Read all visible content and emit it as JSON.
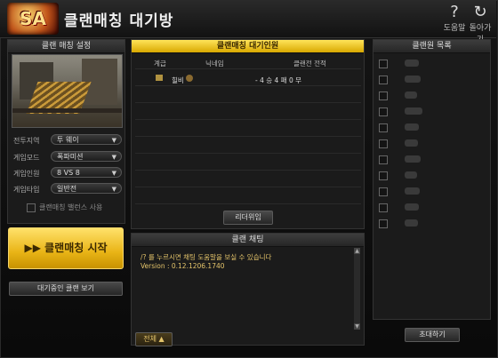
{
  "header": {
    "logo_text": "SA",
    "title": "클랜매칭 대기방",
    "help_label": "도움말",
    "back_label": "돌아가기",
    "help_icon": "question-icon",
    "back_icon": "return-arrow-icon"
  },
  "settings": {
    "title": "클랜 매칭 설정",
    "fields": [
      {
        "label": "전투지역",
        "value": "투 웨이"
      },
      {
        "label": "게임모드",
        "value": "폭파미션"
      },
      {
        "label": "게임인원",
        "value": "8 VS 8"
      },
      {
        "label": "게임타입",
        "value": "일반전"
      }
    ],
    "balance_label": "클랜매칭 밸런스 사용",
    "start_label": "클랜매칭 시작",
    "waiting_clans_label": "대기중인 클랜 보기"
  },
  "waiting": {
    "title": "클랜매칭 대기인원",
    "columns": [
      "계급",
      "닉네임",
      "클랜전 전적"
    ],
    "members": [
      {
        "nickname": "힐비",
        "record": "- 4 승 4 패 0 무"
      }
    ],
    "leader_button": "리더위임"
  },
  "chat": {
    "title": "클랜 채팅",
    "lines": [
      "/? 를 누르시면 채팅 도움말을 보실 수 있습니다",
      "Version : 0.12.1206.1740"
    ],
    "channel_label": "전체 ▲"
  },
  "clan_list": {
    "title": "클랜원 목록",
    "invite_label": "초대하기",
    "row_count": 11
  },
  "colors": {
    "accent_yellow": "#e9b416",
    "chat_text": "#e3c36a",
    "panel_bg": "#1b1b1b"
  }
}
